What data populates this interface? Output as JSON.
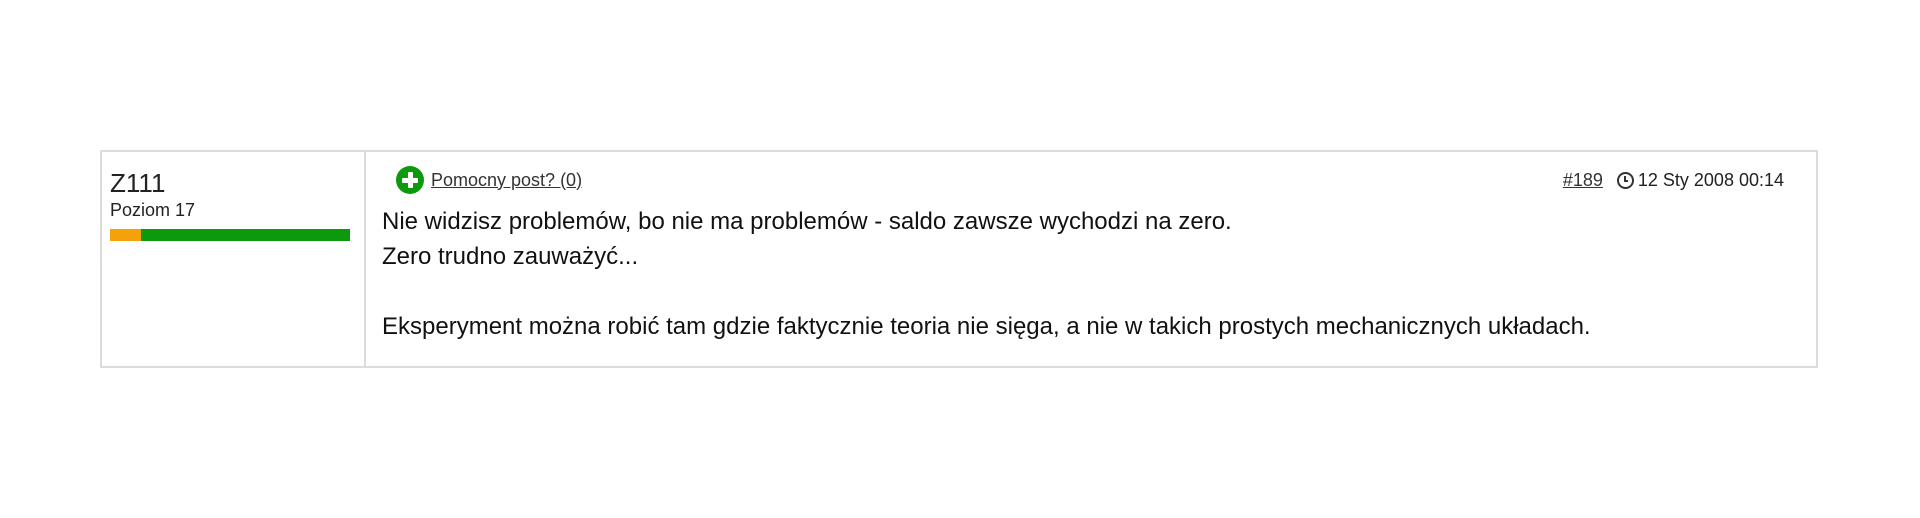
{
  "author": {
    "name": "Z111",
    "level": "Poziom 17",
    "level_progress": 0.13,
    "colors": {
      "progress": "#f5a20a",
      "rest": "#0c9a0c"
    }
  },
  "post": {
    "helpful_label": "Pomocny post? (0)",
    "number": "#189",
    "date": "12 Sty 2008 00:14",
    "lines": [
      "Nie widzisz problemów, bo nie ma problemów - saldo zawsze wychodzi na zero.",
      "Zero trudno zauważyć...",
      "",
      "Eksperyment można robić tam gdzie faktycznie teoria nie sięga, a nie w takich prostych mechanicznych układach."
    ]
  },
  "icons": {
    "helpful": "plus-circle-icon",
    "date": "clock-icon"
  }
}
